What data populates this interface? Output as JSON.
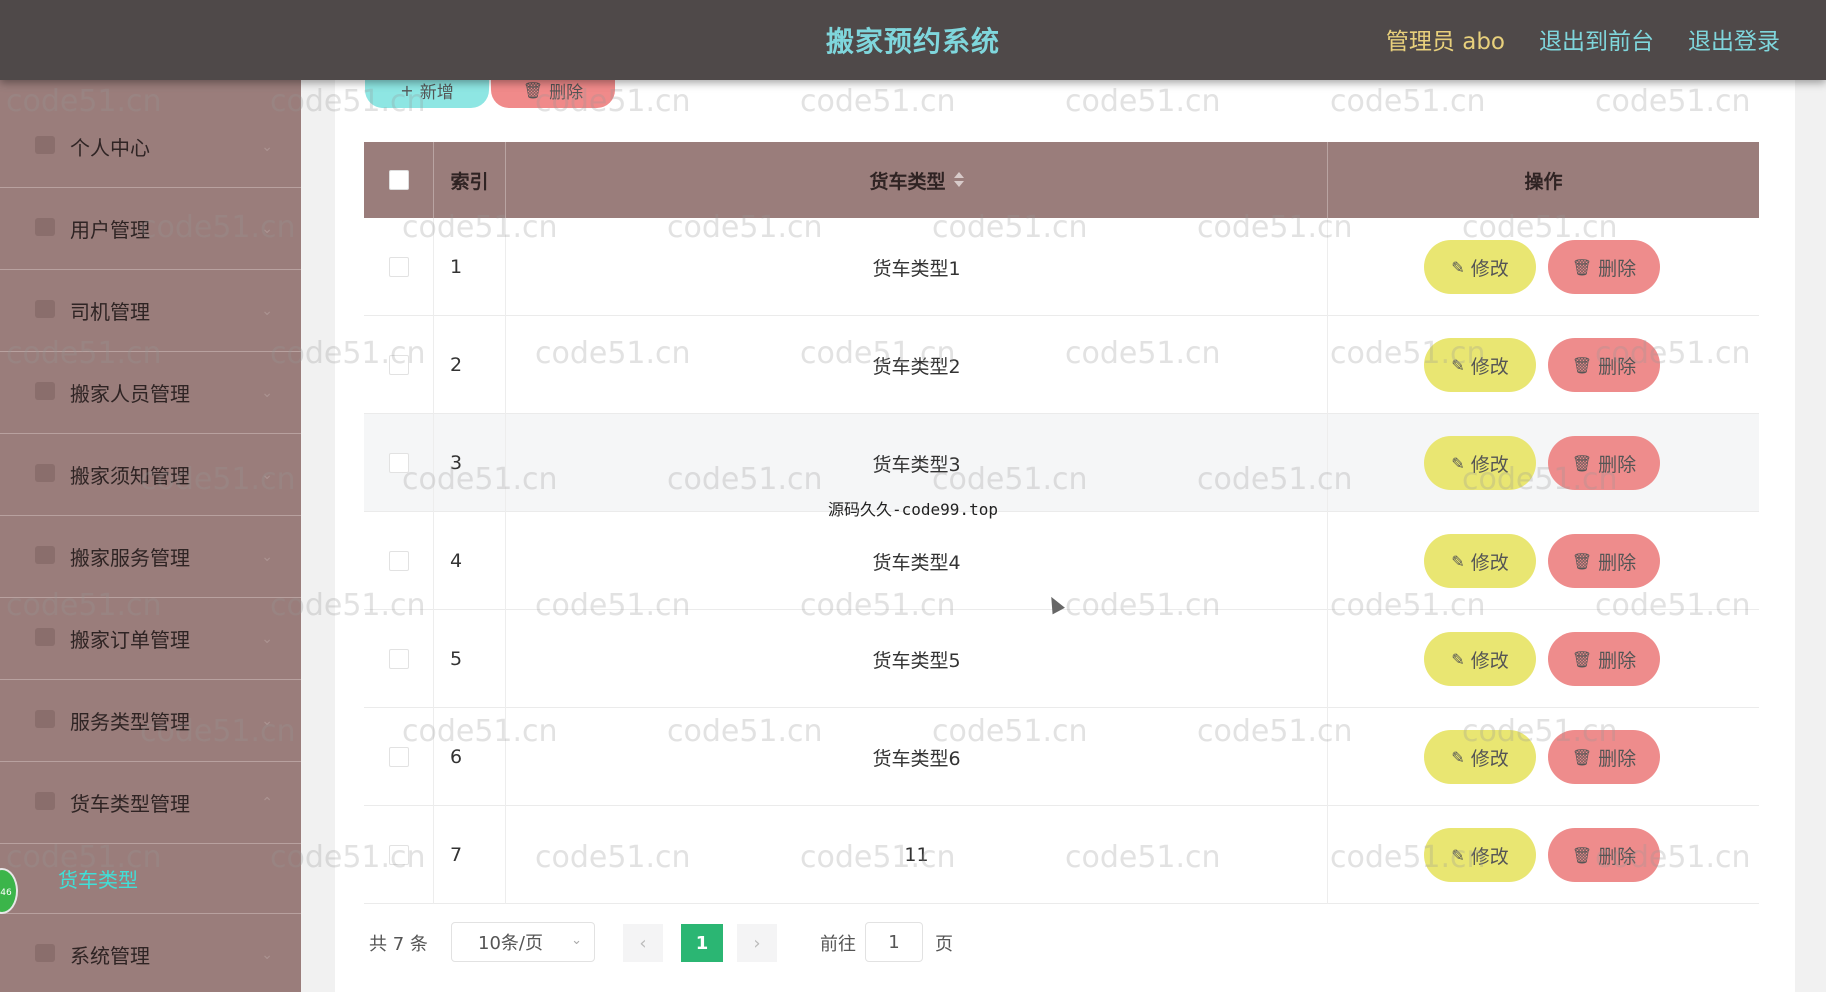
{
  "header": {
    "title": "搬家预约系统",
    "admin": "管理员 abo",
    "links": [
      "退出到前台",
      "退出登录"
    ]
  },
  "sidebar": {
    "items": [
      {
        "label": "个人中心",
        "icon": "user-icon"
      },
      {
        "label": "用户管理",
        "icon": "users-icon"
      },
      {
        "label": "司机管理",
        "icon": "driver-icon"
      },
      {
        "label": "搬家人员管理",
        "icon": "id-card-icon"
      },
      {
        "label": "搬家须知管理",
        "icon": "notice-icon"
      },
      {
        "label": "搬家服务管理",
        "icon": "service-icon"
      },
      {
        "label": "搬家订单管理",
        "icon": "order-icon"
      },
      {
        "label": "服务类型管理",
        "icon": "tag-icon"
      },
      {
        "label": "货车类型管理",
        "icon": "list-icon"
      }
    ],
    "active_sub": "货车类型",
    "last_item": {
      "label": "系统管理",
      "icon": "settings-icon"
    },
    "badge": "46"
  },
  "toolbar": {
    "add_label": "新增",
    "delete_label": "删除"
  },
  "table": {
    "headers": {
      "index": "索引",
      "type": "货车类型",
      "actions": "操作"
    },
    "rows": [
      {
        "index": "1",
        "type": "货车类型1"
      },
      {
        "index": "2",
        "type": "货车类型2"
      },
      {
        "index": "3",
        "type": "货车类型3"
      },
      {
        "index": "4",
        "type": "货车类型4"
      },
      {
        "index": "5",
        "type": "货车类型5"
      },
      {
        "index": "6",
        "type": "货车类型6"
      },
      {
        "index": "7",
        "type": "11"
      }
    ],
    "edit_label": "修改",
    "delete_label": "删除"
  },
  "pagination": {
    "total": "共 7 条",
    "page_size": "10条/页",
    "current_page": "1",
    "goto_prefix": "前往",
    "goto_value": "1",
    "goto_suffix": "页"
  },
  "overlay_text": "源码久久-code99.top",
  "watermark": "code51.cn",
  "colors": {
    "header_bg": "#4f4949",
    "sidebar_bg": "#9a7d7b",
    "title": "#7fd6dc",
    "admin": "#e8d07c",
    "edit_btn": "#e9e672",
    "delete_btn": "#ee8c8c",
    "add_btn": "#8ee6e3",
    "page_active": "#2bb673"
  }
}
